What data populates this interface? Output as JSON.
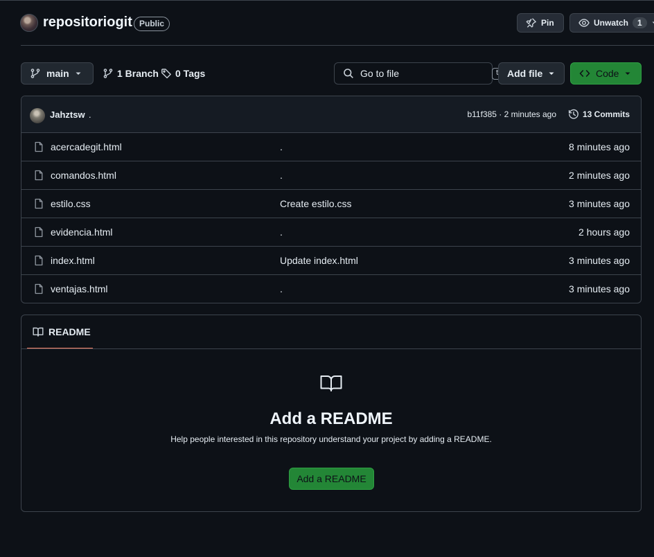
{
  "header": {
    "repo_name": "repositoriogit",
    "visibility": "Public",
    "pin_label": "Pin",
    "watch_label": "Unwatch",
    "watch_count": "1"
  },
  "toolbar": {
    "branch": "main",
    "branches_label": "1 Branch",
    "tags_label": "0 Tags",
    "goto_placeholder": "Go to file",
    "goto_shortcut": "t",
    "add_file_label": "Add file",
    "code_label": "Code"
  },
  "latest_commit": {
    "author": "Jahztsw",
    "message": ".",
    "meta": "b11f385 · 2 minutes ago",
    "commits_label": "13 Commits"
  },
  "files": [
    {
      "name": "acercadegit.html",
      "message": ".",
      "time": "8 minutes ago"
    },
    {
      "name": "comandos.html",
      "message": ".",
      "time": "2 minutes ago"
    },
    {
      "name": "estilo.css",
      "message": "Create estilo.css",
      "time": "3 minutes ago"
    },
    {
      "name": "evidencia.html",
      "message": ".",
      "time": "2 hours ago"
    },
    {
      "name": "index.html",
      "message": "Update index.html",
      "time": "3 minutes ago"
    },
    {
      "name": "ventajas.html",
      "message": ".",
      "time": "3 minutes ago"
    }
  ],
  "readme": {
    "tab_label": "README",
    "title": "Add a README",
    "description": "Help people interested in this repository understand your project by adding a README.",
    "button_label": "Add a README"
  },
  "colors": {
    "background": "#0d1117",
    "border": "#3d444d",
    "green_button": "#238636",
    "tab_underline": "#f78166"
  }
}
